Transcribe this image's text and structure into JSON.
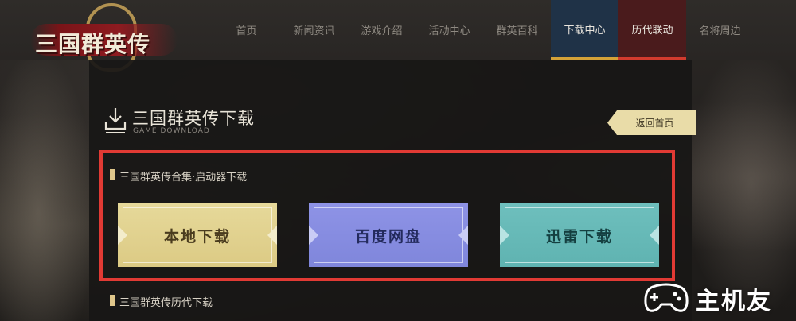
{
  "site": {
    "logo_text": "三国群英传"
  },
  "nav": {
    "items": [
      {
        "label": "首页"
      },
      {
        "label": "新闻资讯"
      },
      {
        "label": "游戏介绍"
      },
      {
        "label": "活动中心"
      },
      {
        "label": "群英百科"
      },
      {
        "label": "下载中心",
        "state": "active"
      },
      {
        "label": "历代联动",
        "state": "active-red"
      },
      {
        "label": "名将周边"
      }
    ]
  },
  "page": {
    "title": "三国群英传下载",
    "subtitle": "GAME DOWNLOAD",
    "back_label": "返回首页",
    "title_icon": "download-icon"
  },
  "sections": [
    {
      "label": "三国群英传合集·启动器下载",
      "buttons": [
        {
          "label": "本地下载",
          "color": "#e6d99a"
        },
        {
          "label": "百度网盘",
          "color": "#8e93e6"
        },
        {
          "label": "迅雷下载",
          "color": "#6ebfbd"
        }
      ]
    },
    {
      "label": "三国群英传历代下载"
    }
  ],
  "highlight_color": "#e13a34",
  "watermark": {
    "text": "主机友",
    "icon": "gamepad-icon"
  }
}
